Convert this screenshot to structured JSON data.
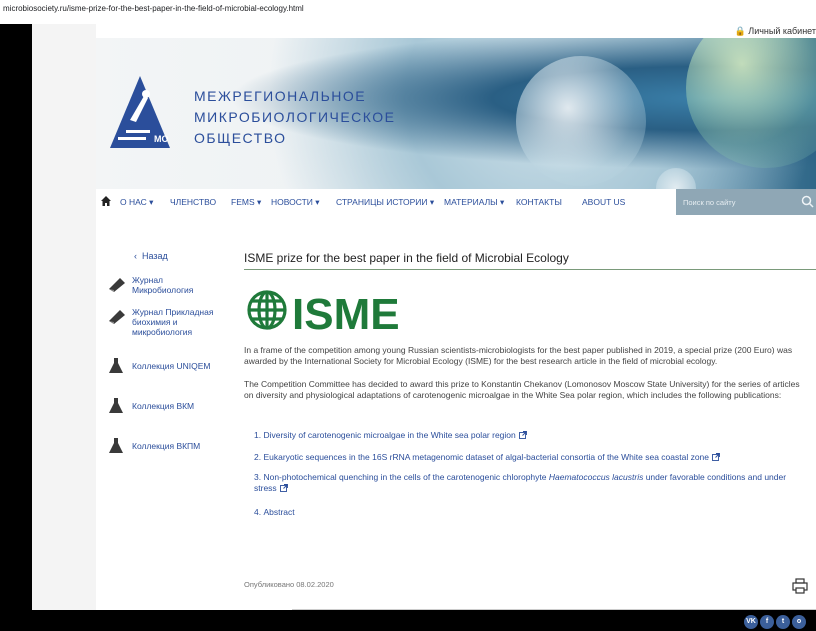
{
  "browser": {
    "url": "microbiosociety.ru/isme-prize-for-the-best-paper-in-the-field-of-microbial-ecology.html"
  },
  "topbar": {
    "cabinet_label": "Личный кабинет"
  },
  "header": {
    "logo_line1": "МЕЖРЕГИОНАЛЬНОЕ",
    "logo_line2": "МИКРОБИОЛОГИЧЕСКОЕ",
    "logo_line3": "ОБЩЕСТВО",
    "logo_mark": "МО"
  },
  "nav": {
    "items": [
      "О НАС ▾",
      "ЧЛЕНСТВО",
      "FEMS ▾",
      "НОВОСТИ ▾",
      "СТРАНИЦЫ ИСТОРИИ ▾",
      "МАТЕРИАЛЫ ▾",
      "КОНТАКТЫ",
      "ABOUT US"
    ],
    "search_placeholder": "Поиск по сайту"
  },
  "sidebar": {
    "back_label": "Назад",
    "items": [
      {
        "label": "Журнал Микробиология",
        "icon": "journal-icon"
      },
      {
        "label": "Журнал Прикладная биохимия и микробиология",
        "icon": "journal-icon"
      },
      {
        "label": "Коллекция UNIQEM",
        "icon": "flask-icon"
      },
      {
        "label": "Коллекция ВКМ",
        "icon": "flask-icon"
      },
      {
        "label": "Коллекция ВКПМ",
        "icon": "flask-icon"
      }
    ]
  },
  "article": {
    "title": "ISME prize for the best paper in the field of Microbial Ecology",
    "logo_text": "ISME",
    "para1": "In a frame of the competition among young Russian scientists-microbiologists for the best paper published in 2019, a special prize (200 Euro) was awarded by the International Society for Microbial Ecology (ISME) for the best research article in the field of microbial ecology.",
    "para2": "The Competition Committee has decided to award this prize to Konstantin Chekanov (Lomonosov Moscow State University) for the series of articles on diversity and physiological adaptations of carotenogenic microalgae in the White Sea polar region, which includes the following publications:",
    "pub1": "Diversity of carotenogenic microalgae in the White sea polar region",
    "pub2": "Eukaryotic sequences in the 16S rRNA metagenomic dataset of algal-bacterial consortia of the White sea coastal zone",
    "pub3_a": "Non-photochemical quenching in the cells of the carotenogenic chlorophyte ",
    "pub3_italic": "Haematococcus lacustris",
    "pub3_b": " under favorable conditions and under stress",
    "pub4": "Abstract",
    "published": "Опубликовано 08.02.2020"
  },
  "socials": [
    "VK",
    "f",
    "t",
    "o"
  ],
  "colors": {
    "accent": "#2b4e9b",
    "search_bg": "#8fa7b5",
    "isme_green": "#1f7a3a"
  }
}
